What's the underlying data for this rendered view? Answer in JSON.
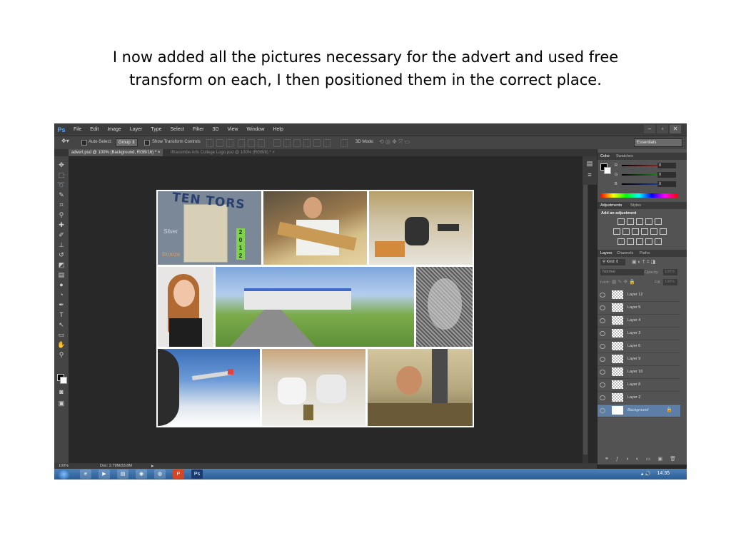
{
  "caption": {
    "line1": "I now added all the pictures necessary for the advert and used free",
    "line2": "transform on each,  I then positioned them in the correct place."
  },
  "app": {
    "logo": "Ps",
    "menu": [
      "File",
      "Edit",
      "Image",
      "Layer",
      "Type",
      "Select",
      "Filter",
      "3D",
      "View",
      "Window",
      "Help"
    ],
    "window_controls": [
      "–",
      "▫",
      "✕"
    ]
  },
  "options": {
    "auto_select_label": "Auto-Select:",
    "auto_select_value": "Group",
    "show_transform_label": "Show Transform Controls",
    "mode_3d_label": "3D Mode:",
    "workspace": "Essentials"
  },
  "tabs": [
    {
      "label": "advert.psd @ 100% (Background, RGB/16) *",
      "close": "×"
    },
    {
      "label": "Ilfracombe Arts College Logo.psd @ 100% (RGB/8) *",
      "close": "×"
    }
  ],
  "tools": [
    "move-tool",
    "marquee-tool",
    "lasso-tool",
    "quick-select-tool",
    "crop-tool",
    "eyedropper-tool",
    "healing-tool",
    "brush-tool",
    "stamp-tool",
    "history-brush-tool",
    "eraser-tool",
    "gradient-tool",
    "blur-tool",
    "dodge-tool",
    "pen-tool",
    "type-tool",
    "path-select-tool",
    "shape-tool",
    "hand-tool",
    "zoom-tool"
  ],
  "color_panel": {
    "tabs": [
      "Color",
      "Swatches"
    ],
    "channels": [
      {
        "label": "R",
        "value": "0",
        "color": "#e03030"
      },
      {
        "label": "G",
        "value": "0",
        "color": "#30c030"
      },
      {
        "label": "B",
        "value": "0",
        "color": "#3050e0"
      }
    ]
  },
  "adjustments_panel": {
    "tabs": [
      "Adjustments",
      "Styles"
    ],
    "heading": "Add an adjustment"
  },
  "layers_panel": {
    "tabs": [
      "Layers",
      "Channels",
      "Paths"
    ],
    "kind_label": "Kind",
    "blend_mode": "Normal",
    "opacity_label": "Opacity:",
    "opacity_value": "100%",
    "lock_label": "Lock:",
    "fill_label": "Fill:",
    "fill_value": "100%",
    "layers": [
      {
        "name": "Layer 12"
      },
      {
        "name": "Layer 5"
      },
      {
        "name": "Layer 4"
      },
      {
        "name": "Layer 3"
      },
      {
        "name": "Layer 6"
      },
      {
        "name": "Layer 9"
      },
      {
        "name": "Layer 10"
      },
      {
        "name": "Layer 8"
      },
      {
        "name": "Layer 2"
      },
      {
        "name": "Background",
        "selected": true
      }
    ]
  },
  "photo_text": {
    "ten_tors": "TEN TORS",
    "silver": "Silver",
    "bronze": "Bronze",
    "year_digits": [
      "2",
      "0",
      "1",
      "2"
    ]
  },
  "status": {
    "zoom": "100%",
    "doc": "Doc: 2.79M/33.8M"
  },
  "taskbar": {
    "time": "14:35",
    "pinned": [
      "ie-icon",
      "media-player-icon",
      "explorer-icon",
      "chrome-icon",
      "firefox-icon",
      "powerpoint-icon",
      "photoshop-icon"
    ]
  }
}
